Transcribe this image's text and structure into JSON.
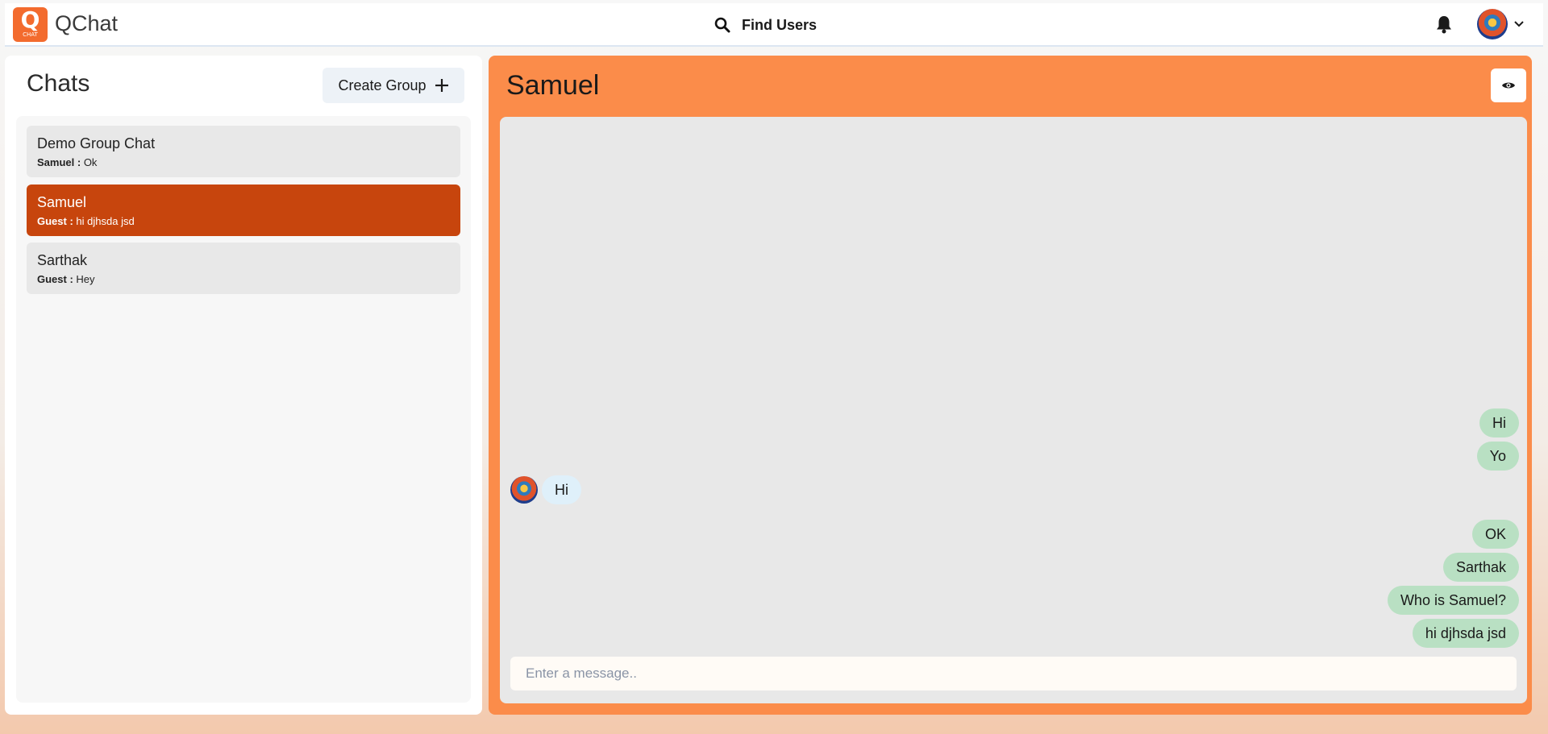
{
  "header": {
    "logo_letter": "Q",
    "logo_subtext": "CHAT",
    "app_title": "QChat",
    "find_users_label": "Find Users"
  },
  "sidebar": {
    "title": "Chats",
    "create_group_label": "Create Group",
    "chats": [
      {
        "name": "Demo Group Chat",
        "sender": "Samuel :",
        "preview": "Ok",
        "active": false
      },
      {
        "name": "Samuel",
        "sender": "Guest :",
        "preview": "hi djhsda jsd",
        "active": true
      },
      {
        "name": "Sarthak",
        "sender": "Guest :",
        "preview": "Hey",
        "active": false
      }
    ]
  },
  "conversation": {
    "title": "Samuel",
    "messages": [
      {
        "text": "Hi",
        "mine": true
      },
      {
        "text": "Yo",
        "mine": true
      },
      {
        "text": "Hi",
        "mine": false
      },
      {
        "text": "OK",
        "mine": true
      },
      {
        "text": "Sarthak",
        "mine": true
      },
      {
        "text": "Who is Samuel?",
        "mine": true
      },
      {
        "text": "hi djhsda jsd",
        "mine": true
      }
    ],
    "input_placeholder": "Enter a message.."
  },
  "colors": {
    "brand": "#f36b2e",
    "active_chat": "#c7450d",
    "chat_panel": "#fb8c4a",
    "my_bubble": "#b9e0c3",
    "their_bubble": "#dff0fa"
  },
  "icons": {
    "search": "search-icon",
    "bell": "bell-icon",
    "chevron": "chevron-down-icon",
    "plus": "plus-icon",
    "eye": "eye-icon"
  }
}
